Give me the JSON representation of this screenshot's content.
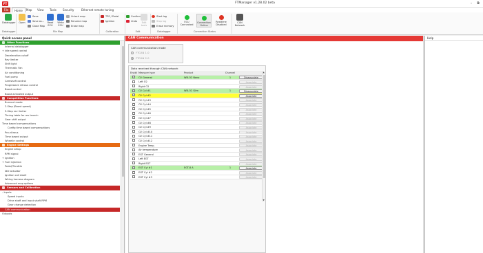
{
  "window": {
    "title": "FTManager v1.28.02 beta",
    "logo": "FT"
  },
  "menu": {
    "file": "File",
    "tabs": [
      "Home",
      "Map",
      "View",
      "Tools",
      "Security",
      "Ethernet remote tuning"
    ]
  },
  "ribbon": {
    "datalogger_group": "Datalogger",
    "datalogger_btn": "Datalogger",
    "open_btn": "Open",
    "save_btn": "Save",
    "save_as_btn": "Save as...",
    "close_map_btn": "Close Map",
    "read_ecu_btn": "Read\nECU",
    "write_ecu_btn": "Write\nECU",
    "unlock_map_btn": "Unlock map",
    "rename_map_btn": "Rename map",
    "erase_map_btn": "Erase map",
    "file_map_group": "File Map",
    "tps_pedal_btn": "TPS / Pedal",
    "ignition_btn": "Ignition",
    "calibration_group": "Calibration",
    "confirm_btn": "Confirm",
    "undo_btn": "Undo",
    "edit_group": "Edit",
    "edit_btn": "Edit\ntools",
    "start_log_btn": "Start log",
    "stop_log_btn": "Stop log",
    "erase_memory_btn": "Erase memory",
    "datalogger_group2": "Datalogger",
    "ecu_connected": "ECU\nConnected",
    "connection_online": "Connection\nOnline",
    "realtime_disabled": "Realtime\nDisabled",
    "connection_status_group": "Connection Status",
    "can_network": "CAN\nNetwork"
  },
  "quick_access": {
    "title": "Quick access panel",
    "items": [
      {
        "label": "Other Functions",
        "type": "header-green"
      },
      {
        "label": "Internal datalogger",
        "indent": 1
      },
      {
        "label": "+ Idle speed control",
        "indent": 0
      },
      {
        "label": "Deceleration cutoff",
        "indent": 1
      },
      {
        "label": "Rev limiter",
        "indent": 1
      },
      {
        "label": "Shift light",
        "indent": 1
      },
      {
        "label": "Thermatic Fan",
        "indent": 1
      },
      {
        "label": "Air conditioning",
        "indent": 1
      },
      {
        "label": "Fuel pump",
        "indent": 1
      },
      {
        "label": "Camshaft control",
        "indent": 1
      },
      {
        "label": "Progressive nitrous control",
        "indent": 1
      },
      {
        "label": "Boost control",
        "indent": 1
      },
      {
        "label": "Boost activated output",
        "indent": 1
      },
      {
        "label": "Competition Functions",
        "type": "header-red"
      },
      {
        "label": "Burnout mode",
        "indent": 1
      },
      {
        "label": "2-Step (Boost speed)",
        "indent": 1
      },
      {
        "label": "3-Step rev limiter",
        "indent": 1
      },
      {
        "label": "Timing table for rev launch",
        "indent": 1
      },
      {
        "label": "Gear shift output",
        "indent": 1
      },
      {
        "label": "Time based compensations",
        "indent": 0
      },
      {
        "label": "Config time based compensations",
        "indent": 2
      },
      {
        "label": "Pro-nitrous",
        "indent": 1
      },
      {
        "label": "Time based output",
        "indent": 1
      },
      {
        "label": "Wheelie control",
        "indent": 1
      },
      {
        "label": "Engine Settings",
        "type": "header-orange"
      },
      {
        "label": "Engine setup",
        "indent": 1
      },
      {
        "label": "RPM signal",
        "indent": 1
      },
      {
        "label": "+ Ignition",
        "indent": 0
      },
      {
        "label": "+ Fuel injection",
        "indent": 0
      },
      {
        "label": "Pedal/Throttle",
        "indent": 1
      },
      {
        "label": "Idle actuator",
        "indent": 1
      },
      {
        "label": "Ignition coil dwell",
        "indent": 1
      },
      {
        "label": "Wiring harness diagram",
        "indent": 1
      },
      {
        "label": "Advanced map options",
        "indent": 1
      },
      {
        "label": "Sensors and Calibration",
        "type": "header-red"
      },
      {
        "label": "- Inputs",
        "indent": 0
      },
      {
        "label": "Speed inputs",
        "indent": 2
      },
      {
        "label": "Drive shaft and input shaft RPM",
        "indent": 2
      },
      {
        "label": "Gear change detection",
        "indent": 2
      },
      {
        "label": "CAN communication",
        "type": "selected",
        "indent": 1
      },
      {
        "label": "Outputs",
        "indent": 0
      }
    ]
  },
  "main": {
    "title": "CAN Communication",
    "mode_title": "CAN communication mode",
    "mode_options": [
      "FTCAN 1.0",
      "FTCAN 2.0"
    ],
    "selected_mode": 1,
    "data_title": "Data received through CAN network",
    "columns": [
      "Enabled",
      "Measure type",
      "Product",
      "Channel",
      ""
    ],
    "rows": [
      {
        "enabled": true,
        "measure": "O2 General",
        "product": "WB-O2 Nano",
        "channel": "1",
        "action": "Disassociate",
        "hl": "green"
      },
      {
        "enabled": false,
        "measure": "Left O2",
        "product": "",
        "channel": "",
        "action": "Associate"
      },
      {
        "enabled": false,
        "measure": "Right O2",
        "product": "",
        "channel": "",
        "action": "Associate"
      },
      {
        "enabled": true,
        "measure": "O2 Cyl #1",
        "product": "WB-O2 Slim",
        "channel": "1",
        "action": "Disassociate",
        "hl": "green"
      },
      {
        "enabled": true,
        "measure": "O2 Cyl #2",
        "product": "",
        "channel": "",
        "action": "Associate",
        "hl": "yellow"
      },
      {
        "enabled": false,
        "measure": "O2 Cyl #3",
        "product": "",
        "channel": "",
        "action": "Associate"
      },
      {
        "enabled": false,
        "measure": "O2 Cyl #4",
        "product": "",
        "channel": "",
        "action": "Associate"
      },
      {
        "enabled": false,
        "measure": "O2 Cyl #5",
        "product": "",
        "channel": "",
        "action": "Associate"
      },
      {
        "enabled": false,
        "measure": "O2 Cyl #6",
        "product": "",
        "channel": "",
        "action": "Associate"
      },
      {
        "enabled": false,
        "measure": "O2 Cyl #7",
        "product": "",
        "channel": "",
        "action": "Associate"
      },
      {
        "enabled": false,
        "measure": "O2 Cyl #8",
        "product": "",
        "channel": "",
        "action": "Associate"
      },
      {
        "enabled": false,
        "measure": "O2 Cyl #9",
        "product": "",
        "channel": "",
        "action": "Associate"
      },
      {
        "enabled": false,
        "measure": "O2 Cyl #10",
        "product": "",
        "channel": "",
        "action": "Associate"
      },
      {
        "enabled": false,
        "measure": "O2 Cyl #11",
        "product": "",
        "channel": "",
        "action": "Associate"
      },
      {
        "enabled": false,
        "measure": "O2 Cyl #12",
        "product": "",
        "channel": "",
        "action": "Associate"
      },
      {
        "enabled": false,
        "measure": "Engine Temp.",
        "product": "",
        "channel": "",
        "action": "Associate"
      },
      {
        "enabled": false,
        "measure": "Air temperature",
        "product": "",
        "channel": "",
        "action": "Associate"
      },
      {
        "enabled": false,
        "measure": "EGT General",
        "product": "",
        "channel": "",
        "action": "Associate"
      },
      {
        "enabled": false,
        "measure": "Left EGT",
        "product": "",
        "channel": "",
        "action": "Associate"
      },
      {
        "enabled": false,
        "measure": "Right EGT",
        "product": "",
        "channel": "",
        "action": "Associate"
      },
      {
        "enabled": true,
        "measure": "EGT Cyl #1",
        "product": "EGT-8 A",
        "channel": "1",
        "action": "Associate",
        "hl": "green"
      },
      {
        "enabled": false,
        "measure": "EGT Cyl #2",
        "product": "",
        "channel": "",
        "action": "Associate"
      },
      {
        "enabled": false,
        "measure": "EGT Cyl #3",
        "product": "",
        "channel": "",
        "action": "Associate"
      }
    ]
  },
  "help": {
    "title": "Help"
  },
  "colors": {
    "accent_red": "#e53935",
    "green_header": "#2ea02e",
    "orange_header": "#e66a12",
    "row_green": "#b8f0a8",
    "row_yellow": "#ffff33"
  }
}
